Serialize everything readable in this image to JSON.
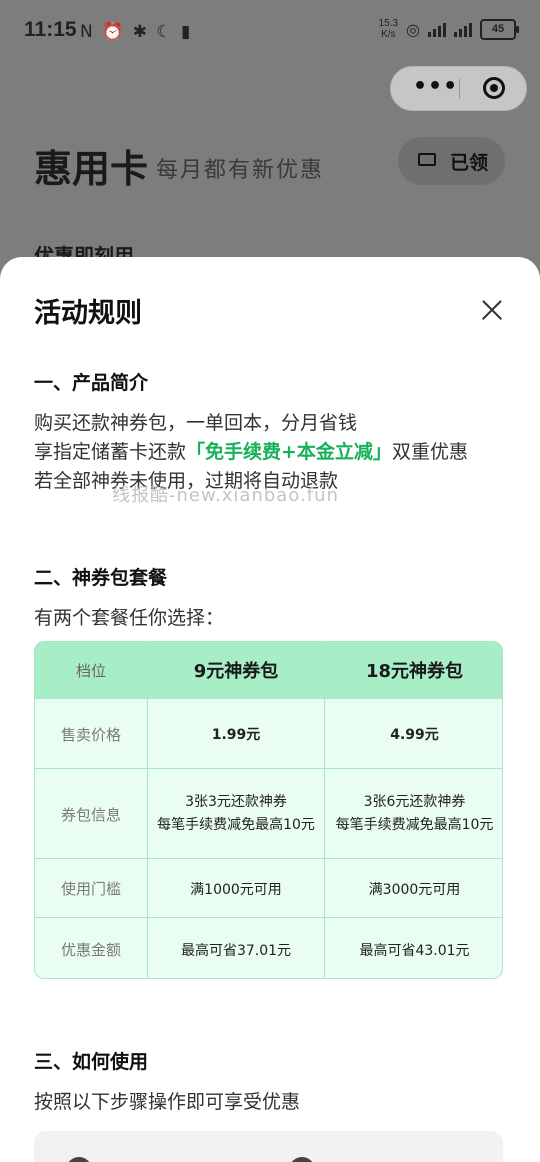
{
  "status_bar": {
    "time": "11:15",
    "left_icons": "N ⏰ ✱ ☾ ▮",
    "net_speed_value": "15.3",
    "net_speed_unit": "K/s",
    "battery": "45"
  },
  "capsule": {
    "more_label": "•••"
  },
  "background": {
    "title": "惠用卡",
    "subtitle": "每月都有新优惠",
    "claimed_button": "已领",
    "section_label": "优惠即刻用"
  },
  "sheet": {
    "title": "活动规则",
    "section1": {
      "heading": "一、产品简介",
      "line1": "购买还款神券包，一单回本，分月省钱",
      "line2_prefix": "享指定储蓄卡还款",
      "line2_highlight": "「免手续费+本金立减」",
      "line2_suffix": "双重优惠",
      "line3": "若全部神券未使用，过期将自动退款"
    },
    "watermark": "线报酷-new.xianbao.fun",
    "section2": {
      "heading": "二、神券包套餐",
      "intro": "有两个套餐任你选择：",
      "table": {
        "header": [
          "档位",
          "9元神券包",
          "18元神券包"
        ],
        "rows": [
          {
            "label": "售卖价格",
            "a": "1.99元",
            "b": "4.99元"
          },
          {
            "label": "券包信息",
            "a1": "3张3元还款神券",
            "a2": "每笔手续费减免最高10元",
            "b1": "3张6元还款神券",
            "b2": "每笔手续费减免最高10元"
          },
          {
            "label": "使用门槛",
            "a": "满1000元可用",
            "b": "满3000元可用"
          },
          {
            "label": "优惠金额",
            "a": "最高可省37.01元",
            "b": "最高可省43.01元"
          }
        ]
      }
    },
    "section3": {
      "heading": "三、如何使用",
      "intro": "按照以下步骤操作即可享受优惠"
    }
  }
}
